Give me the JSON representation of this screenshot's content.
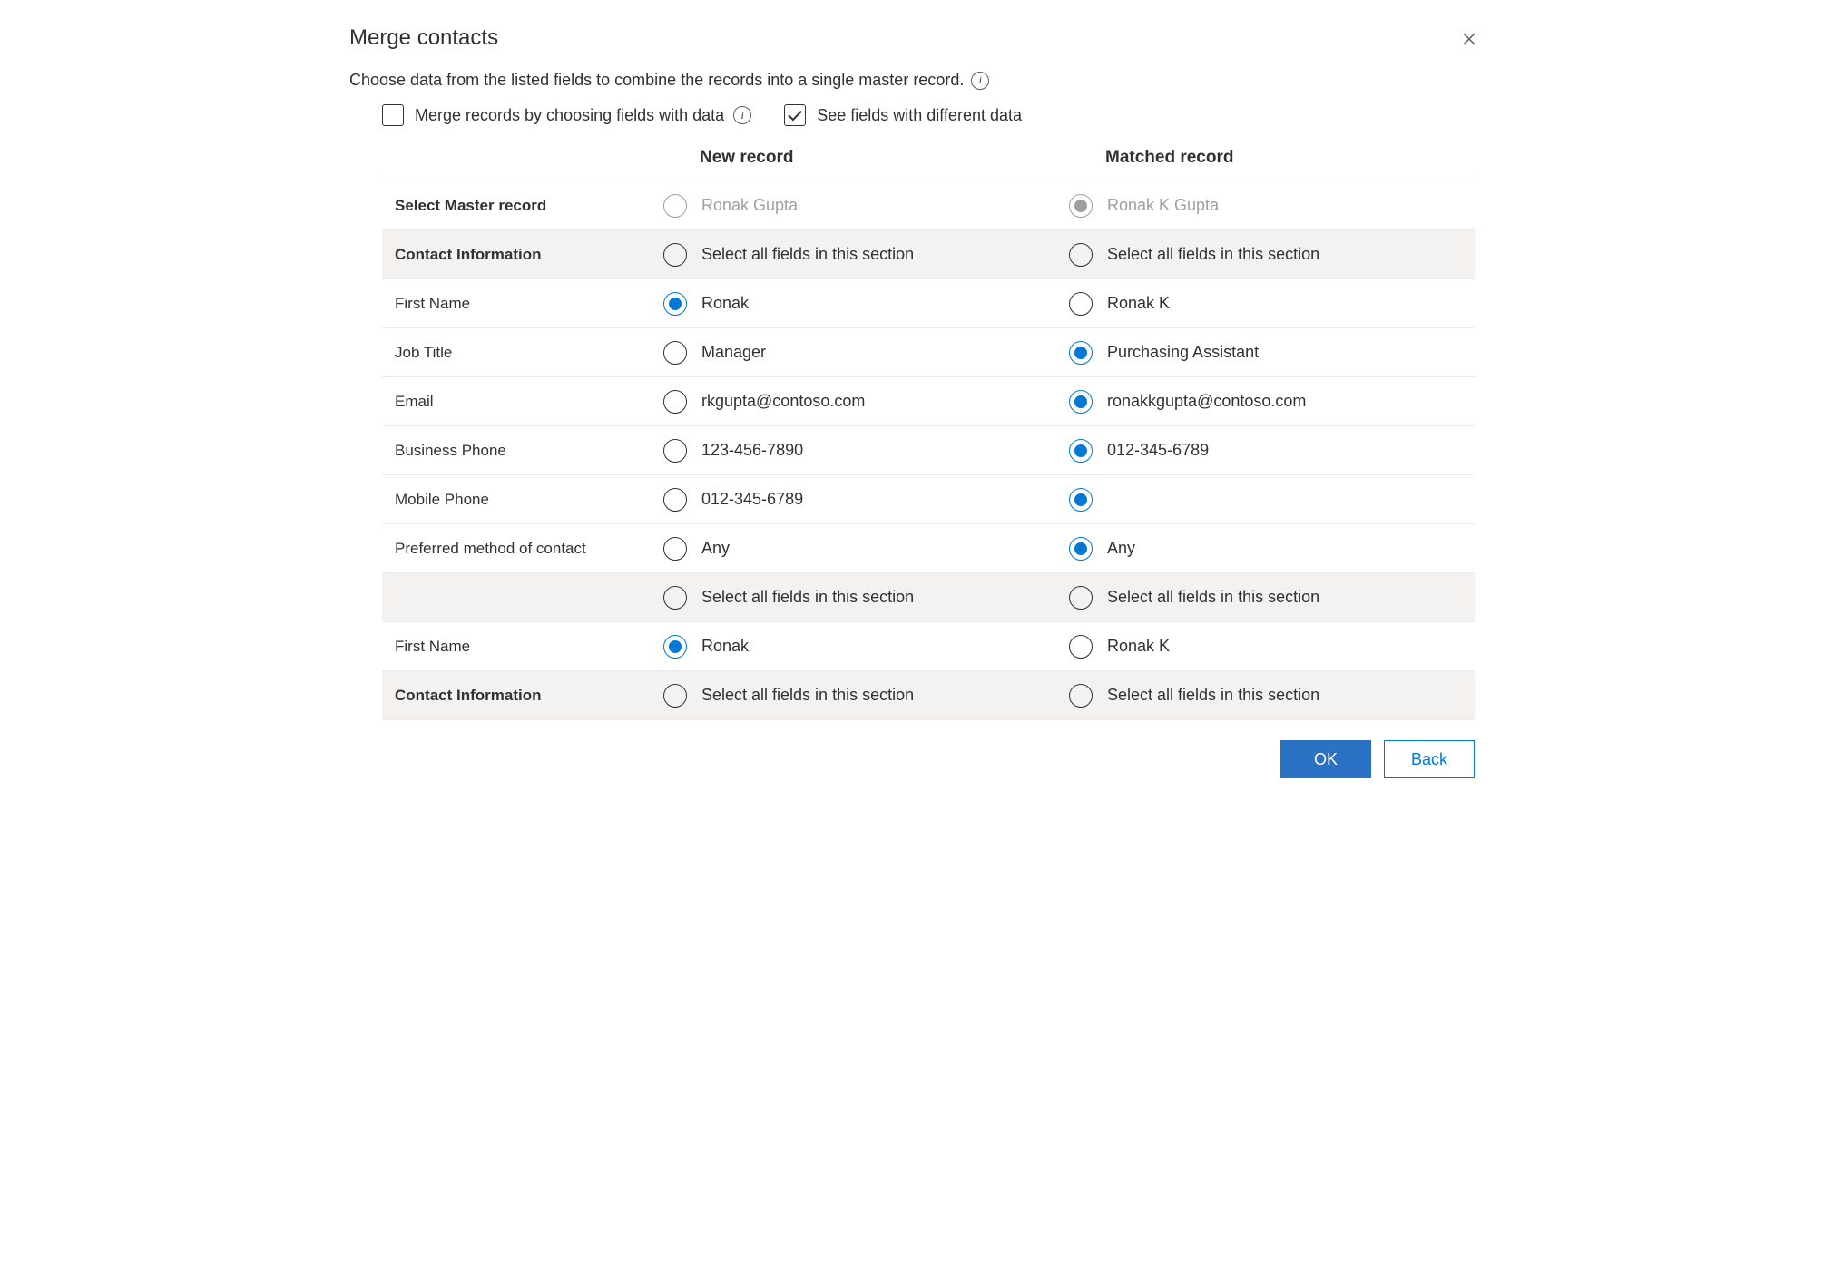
{
  "dialog": {
    "title": "Merge contacts",
    "subtitle": "Choose data from the listed fields to combine the records into a single master record.",
    "options": {
      "merge_by_data": {
        "label": "Merge records by choosing fields with data",
        "checked": false
      },
      "see_diff": {
        "label": "See fields with different data",
        "checked": true
      }
    },
    "column_headers": {
      "left": "",
      "new": "New record",
      "matched": "Matched record"
    },
    "rows": [
      {
        "type": "master",
        "label": "Select Master record",
        "new": {
          "text": "Ronak Gupta",
          "selected": false,
          "disabled": true
        },
        "matched": {
          "text": "Ronak K Gupta",
          "selected": true,
          "disabled": true
        }
      },
      {
        "type": "section",
        "label": "Contact Information",
        "new": {
          "text": "Select all fields in this section",
          "selected": false
        },
        "matched": {
          "text": "Select all fields in this section",
          "selected": false
        }
      },
      {
        "type": "field",
        "label": "First Name",
        "new": {
          "text": "Ronak",
          "selected": true
        },
        "matched": {
          "text": "Ronak K",
          "selected": false
        }
      },
      {
        "type": "field",
        "label": "Job Title",
        "new": {
          "text": "Manager",
          "selected": false
        },
        "matched": {
          "text": "Purchasing Assistant",
          "selected": true
        }
      },
      {
        "type": "field",
        "label": "Email",
        "new": {
          "text": "rkgupta@contoso.com",
          "selected": false
        },
        "matched": {
          "text": "ronakkgupta@contoso.com",
          "selected": true
        }
      },
      {
        "type": "field",
        "label": "Business Phone",
        "new": {
          "text": "123-456-7890",
          "selected": false
        },
        "matched": {
          "text": "012-345-6789",
          "selected": true
        }
      },
      {
        "type": "field",
        "label": "Mobile Phone",
        "new": {
          "text": "012-345-6789",
          "selected": false
        },
        "matched": {
          "text": "",
          "selected": true
        }
      },
      {
        "type": "field",
        "label": "Preferred method of contact",
        "new": {
          "text": "Any",
          "selected": false
        },
        "matched": {
          "text": "Any",
          "selected": true
        }
      },
      {
        "type": "section",
        "label": "",
        "new": {
          "text": "Select all fields in this section",
          "selected": false
        },
        "matched": {
          "text": "Select all fields in this section",
          "selected": false
        }
      },
      {
        "type": "field",
        "label": "First Name",
        "new": {
          "text": "Ronak",
          "selected": true
        },
        "matched": {
          "text": "Ronak K",
          "selected": false
        }
      },
      {
        "type": "section",
        "label": "Contact Information",
        "new": {
          "text": "Select all fields in this section",
          "selected": false
        },
        "matched": {
          "text": "Select all fields in this section",
          "selected": false
        }
      }
    ],
    "buttons": {
      "ok": "OK",
      "back": "Back"
    }
  }
}
